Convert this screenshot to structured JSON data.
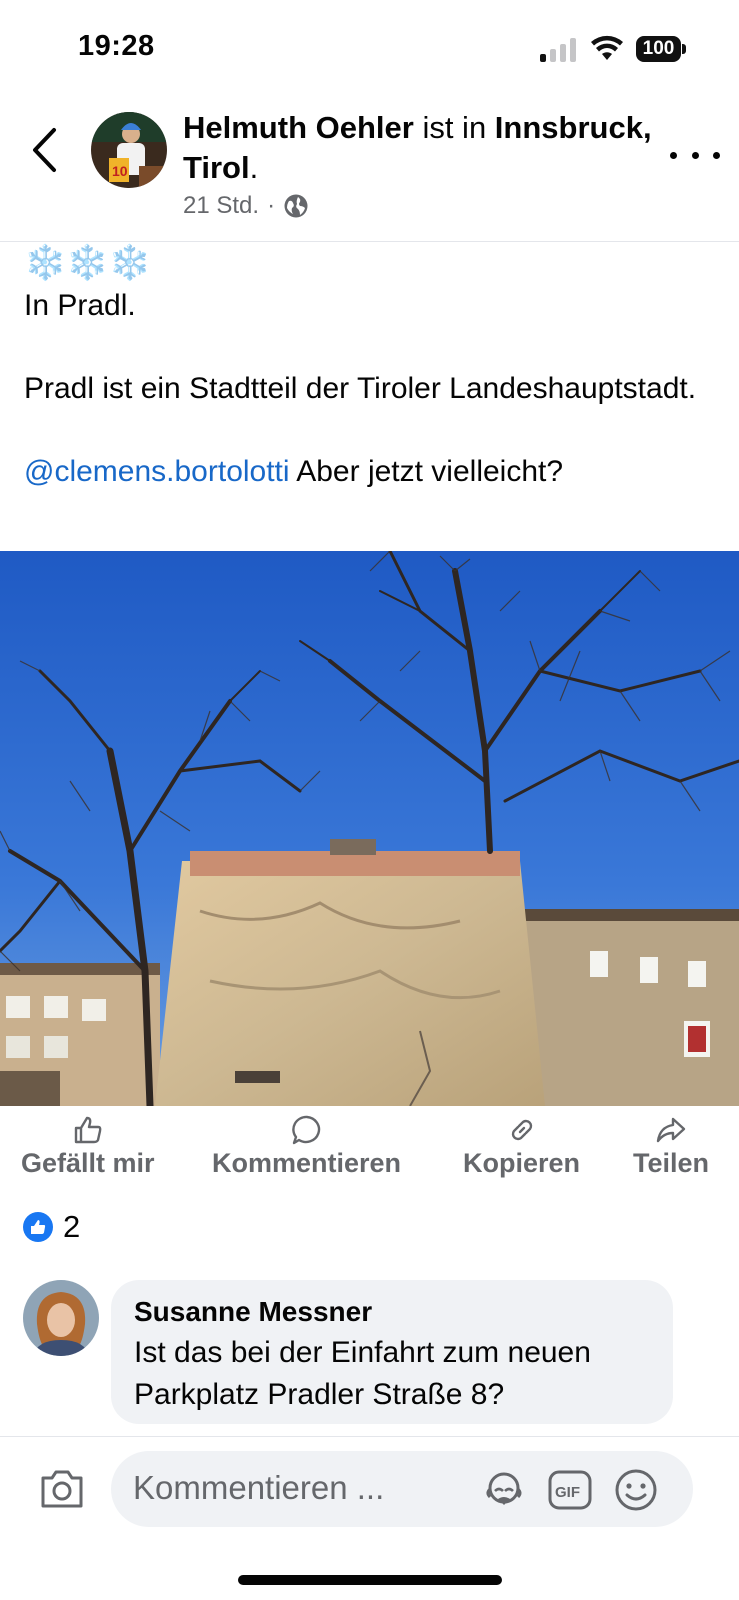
{
  "status": {
    "time": "19:28",
    "battery": "100"
  },
  "header": {
    "author": "Helmuth Oehler",
    "connector": " ist in ",
    "location": "Innsbruck, Tirol",
    "period": ".",
    "time_ago": "21 Std.",
    "separator": "·"
  },
  "post": {
    "snowflakes": "❄️❄️❄️",
    "line1": "In Pradl.",
    "line2": "Pradl ist ein Stadtteil der Tiroler Landeshauptstadt.",
    "mention": "@clemens.bortolotti",
    "after_mention": " Aber jetzt vielleicht?"
  },
  "actions": {
    "like": "Gefällt mir",
    "comment": "Kommentieren",
    "copy": "Kopieren",
    "share": "Teilen"
  },
  "reactions": {
    "count": "2"
  },
  "comment": {
    "author": "Susanne Messner",
    "text": "Ist das bei der Einfahrt zum neuen Parkplatz Pradler Straße 8?"
  },
  "composer": {
    "placeholder": "Kommentieren ..."
  },
  "icons": {
    "back": "chevron-left-icon",
    "more": "more-icon",
    "globe": "globe-icon",
    "like": "thumbs-up-icon",
    "comment": "speech-bubble-icon",
    "copy": "link-icon",
    "share": "share-arrow-icon",
    "camera": "camera-icon",
    "avatar_sticker": "avatar-sticker-icon",
    "gif": "gif-icon",
    "emoji": "emoji-icon"
  },
  "colors": {
    "link": "#1868c8",
    "like_blue": "#1877f2",
    "muted": "#65676b",
    "bubble": "#f0f2f5"
  }
}
